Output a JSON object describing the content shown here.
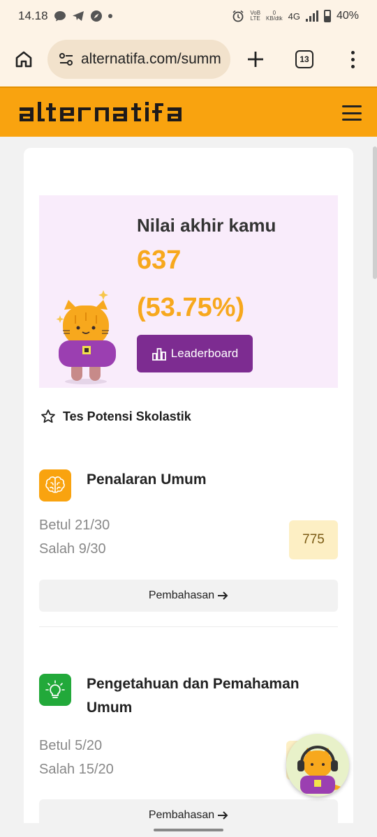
{
  "status_bar": {
    "time": "14.18",
    "volte_top": "VoB",
    "volte_bottom": "LTE",
    "speed_top": "0",
    "speed_bottom": "KB/dtk",
    "network": "4G",
    "battery": "40%"
  },
  "browser": {
    "url": "alternatifa.com/summ",
    "tab_count": "13"
  },
  "site": {
    "logo_text": "alternatifa"
  },
  "result": {
    "title": "Nilai akhir kamu",
    "score": "637",
    "percent": "(53.75%)",
    "leaderboard_label": "Leaderboard"
  },
  "category": {
    "label": "Tes Potensi Skolastik"
  },
  "subtests": [
    {
      "name": "Penalaran Umum",
      "correct": "Betul 21/30",
      "wrong": "Salah 9/30",
      "score": "775",
      "explain_label": "Pembahasan",
      "icon": "brain-icon",
      "icon_color": "#f9a30f"
    },
    {
      "name": "Pengetahuan dan Pemahaman Umum",
      "correct": "Betul 5/20",
      "wrong": "Salah 15/20",
      "score": "",
      "explain_label": "Pembahasan",
      "icon": "lightbulb-icon",
      "icon_color": "#22a93a"
    }
  ],
  "colors": {
    "brand_orange": "#f9a30f",
    "brand_purple": "#7d2c91",
    "score_accent": "#f7a81d"
  }
}
